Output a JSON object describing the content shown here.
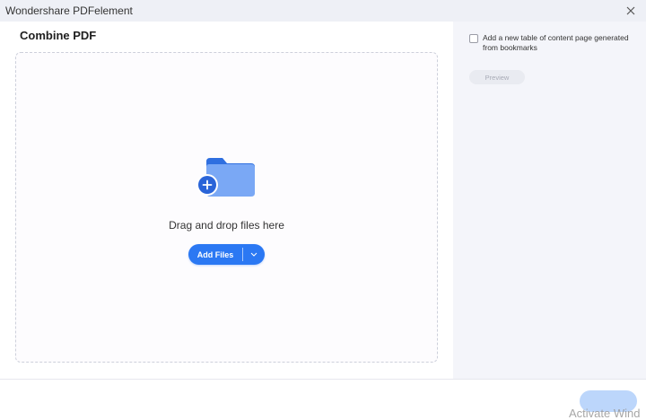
{
  "window": {
    "title": "Wondershare PDFelement",
    "close_icon": "close-icon"
  },
  "main": {
    "heading": "Combine PDF",
    "dropzone": {
      "icon": "folder-add-icon",
      "text": "Drag and drop files here",
      "add_button_label": "Add Files",
      "dropdown_icon": "chevron-down-icon"
    }
  },
  "sidebar": {
    "toc_checkbox": {
      "checked": false,
      "label": "Add a new table of content page generated from bookmarks"
    },
    "preview_label": "Preview"
  },
  "footer": {
    "apply_label": "",
    "watermark": "Activate Wind"
  },
  "colors": {
    "accent": "#2b78f3",
    "titlebar": "#eef0f6",
    "sidebar_bg": "#f4f5fa",
    "disabled_button": "#bcd6fb"
  }
}
